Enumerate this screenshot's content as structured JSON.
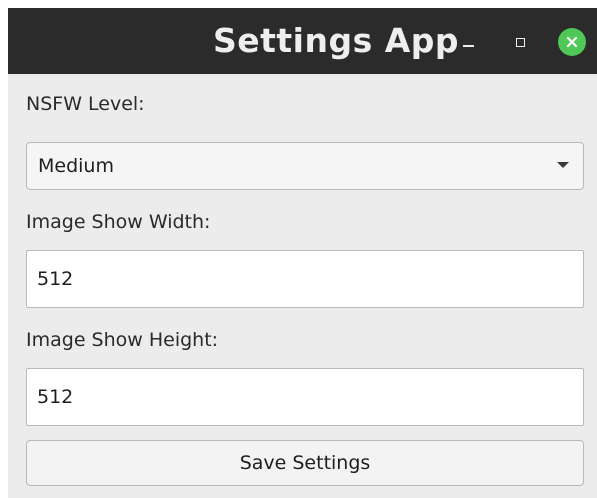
{
  "window": {
    "title": "Settings App",
    "controls": {
      "minimize_icon": "minimize-icon",
      "maximize_icon": "maximize-icon",
      "close_icon": "close-icon"
    },
    "colors": {
      "titlebar": "#2b2b2b",
      "close_button": "#4fc857",
      "body": "#ececec"
    }
  },
  "form": {
    "nsfw_level": {
      "label": "NSFW Level:",
      "selected": "Medium"
    },
    "image_show_width": {
      "label": "Image Show Width:",
      "value": "512"
    },
    "image_show_height": {
      "label": "Image Show Height:",
      "value": "512"
    },
    "save_label": "Save Settings"
  }
}
